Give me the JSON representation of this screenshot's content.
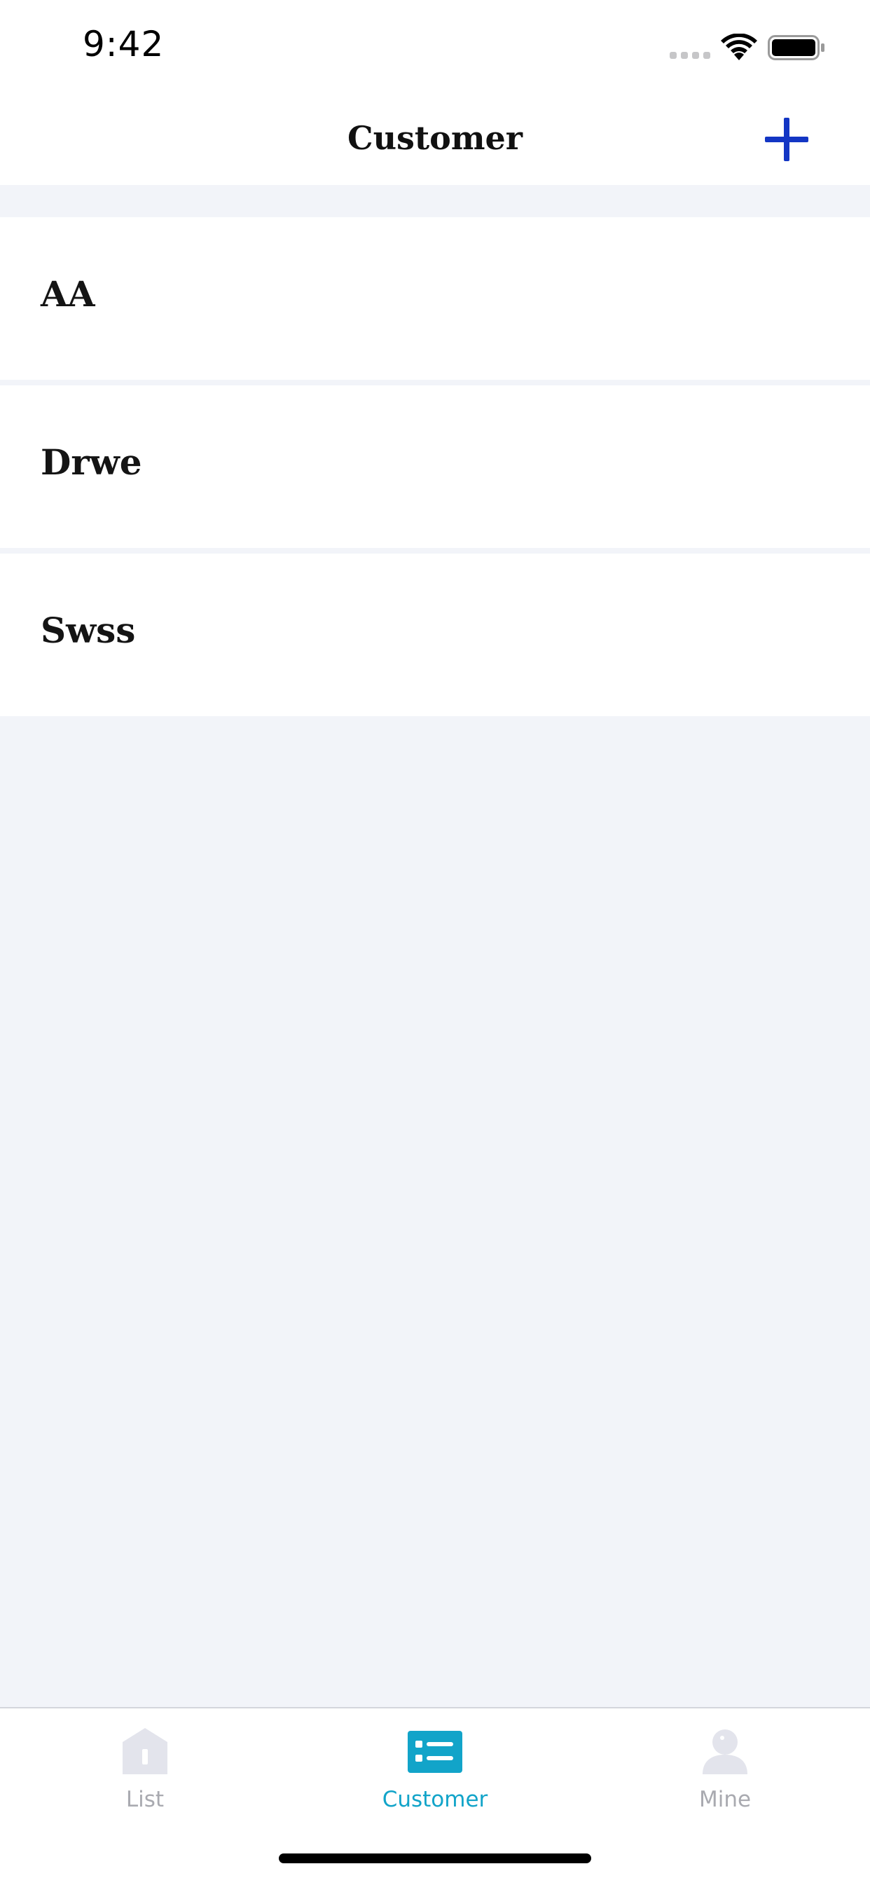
{
  "status_bar": {
    "time": "9:42"
  },
  "nav": {
    "title": "Customer",
    "add_icon": "plus-icon"
  },
  "customers": [
    {
      "name": "AA"
    },
    {
      "name": "Drwe"
    },
    {
      "name": "Swss"
    }
  ],
  "tab_bar": {
    "tabs": [
      {
        "label": "List",
        "icon": "home-icon",
        "active": false
      },
      {
        "label": "Customer",
        "icon": "list-card-icon",
        "active": true
      },
      {
        "label": "Mine",
        "icon": "person-icon",
        "active": false
      }
    ]
  },
  "colors": {
    "accent_tab": "#12a4c9",
    "add_button": "#1336c4",
    "inactive_tab": "#a9aab0",
    "background": "#f2f4f9"
  }
}
